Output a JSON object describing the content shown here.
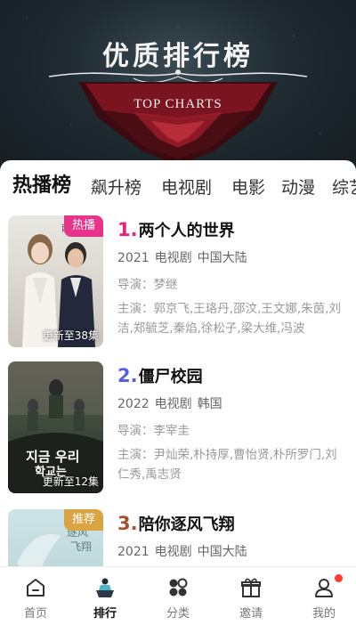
{
  "banner": {
    "title": "优质排行榜",
    "subtitle": "TOP CHARTS"
  },
  "tabs": [
    "热播榜",
    "飙升榜",
    "电视剧",
    "电影",
    "动漫",
    "综艺"
  ],
  "items": [
    {
      "rank": "1.",
      "rank_color": "#e6207c",
      "title": "两个人的世界",
      "year": "2021",
      "type": "电视剧",
      "region": "中国大陆",
      "director": "导演：梦继",
      "cast": "主演：郭京飞,王珞丹,邵汶,王文娜,朱茵,刘洁,郑毓芝,秦焰,徐松子,梁大维,冯波",
      "badge": "热播",
      "badge_color": "#e8338a",
      "episodes": "更新至38集"
    },
    {
      "rank": "2.",
      "rank_color": "#5a5ee6",
      "title": "僵尸校园",
      "year": "2022",
      "type": "电视剧",
      "region": "韩国",
      "director": "导演：李宰圭",
      "cast": "主演：尹灿荣,朴持厚,曹怡贤,朴所罗门,刘仁秀,禹志贤",
      "badge": "",
      "badge_color": "",
      "episodes": "更新至12集"
    },
    {
      "rank": "3.",
      "rank_color": "#a0522d",
      "title": "陪你逐风飞翔",
      "year": "2021",
      "type": "电视剧",
      "region": "中国大陆",
      "director": "",
      "cast": "",
      "badge": "推荐",
      "badge_color": "#d9a441",
      "episodes": ""
    }
  ],
  "nav": [
    {
      "label": "首页",
      "icon": "home-icon"
    },
    {
      "label": "排行",
      "icon": "rank-icon"
    },
    {
      "label": "分类",
      "icon": "category-icon"
    },
    {
      "label": "邀请",
      "icon": "gift-icon"
    },
    {
      "label": "我的",
      "icon": "profile-icon"
    }
  ]
}
